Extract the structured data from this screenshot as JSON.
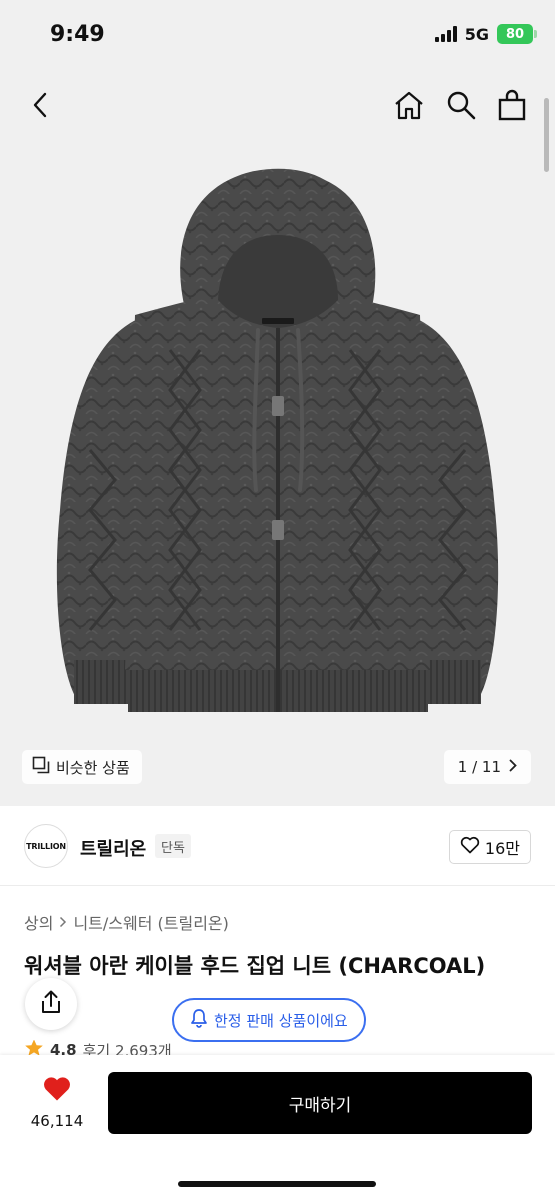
{
  "status_bar": {
    "time": "9:49",
    "network": "5G",
    "battery": "80"
  },
  "gallery": {
    "similar_label": "비슷한 상품",
    "counter": "1 / 11",
    "image_alt": "charcoal cable knit hooded zip-up sweater"
  },
  "brand": {
    "logo_text": "TRILLION",
    "name": "트릴리온",
    "badge": "단독",
    "like_count": "16만"
  },
  "breadcrumb": [
    "상의",
    "니트/스웨터 (트릴리온)"
  ],
  "product": {
    "title": "워셔블 아란 케이블 후드 집업 니트 (CHARCOAL)",
    "limited_label": "한정 판매 상품이에요",
    "rating": "4.8",
    "reviews": "후기 2,693개"
  },
  "bottom": {
    "wish_count": "46,114",
    "buy_label": "구매하기"
  },
  "colors": {
    "accent_blue": "#3b6ff0",
    "heart_red": "#e0201c",
    "star_orange": "#f5a623",
    "buy_black": "#000000"
  },
  "icons": [
    "back-icon",
    "home-icon",
    "search-icon",
    "bag-icon",
    "similar-icon",
    "chevron-right-icon",
    "heart-outline-icon",
    "share-icon",
    "bell-icon",
    "star-icon",
    "heart-filled-icon"
  ]
}
